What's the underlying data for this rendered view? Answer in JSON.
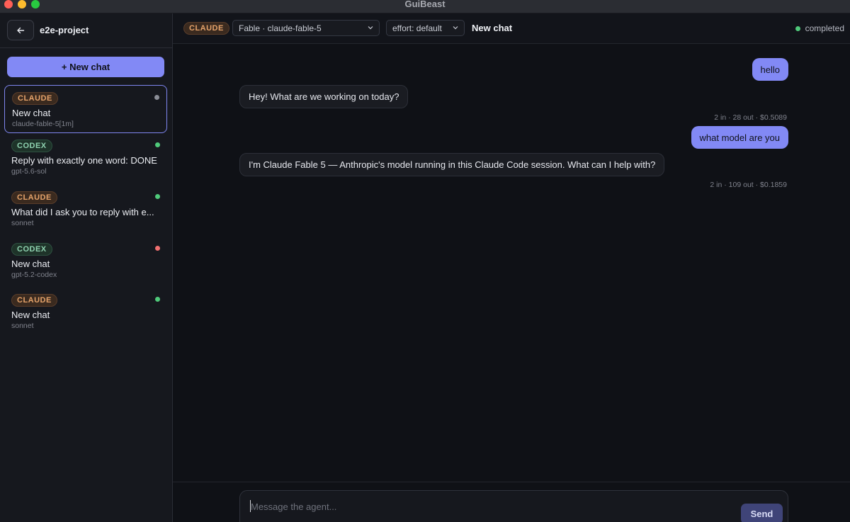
{
  "window": {
    "title": "GuiBeast"
  },
  "sidebar": {
    "back_icon": "arrow-left-icon",
    "project_name": "e2e-project",
    "new_chat_label": "+ New chat",
    "chats": [
      {
        "provider": "CLAUDE",
        "title": "New chat",
        "model": "claude-fable-5[1m]",
        "status_color": "#8a8d96",
        "selected": true
      },
      {
        "provider": "CODEX",
        "title": "Reply with exactly one word: DONE",
        "model": "gpt-5.6-sol",
        "status_color": "#4fc97a",
        "selected": false
      },
      {
        "provider": "CLAUDE",
        "title": "What did I ask you to reply with e...",
        "model": "sonnet",
        "status_color": "#4fc97a",
        "selected": false
      },
      {
        "provider": "CODEX",
        "title": "New chat",
        "model": "gpt-5.2-codex",
        "status_color": "#f07070",
        "selected": false
      },
      {
        "provider": "CLAUDE",
        "title": "New chat",
        "model": "sonnet",
        "status_color": "#4fc97a",
        "selected": false
      }
    ]
  },
  "topbar": {
    "provider_badge": "CLAUDE",
    "model_select_value": "Fable · claude-fable-5",
    "effort_select_value": "effort: default",
    "chat_title": "New chat",
    "status_text": "completed",
    "status_color": "#4fc97a"
  },
  "messages": [
    {
      "role": "user",
      "text": "hello"
    },
    {
      "role": "agent",
      "text": "Hey! What are we working on today?",
      "meta": "2 in · 28 out · $0.5089"
    },
    {
      "role": "user",
      "text": "what model are you"
    },
    {
      "role": "agent",
      "text": "I'm Claude Fable 5 — Anthropic's model running in this Claude Code session. What can I help with?",
      "meta": "2 in · 109 out · $0.1859"
    }
  ],
  "composer": {
    "placeholder": "Message the agent...",
    "value": "",
    "send_label": "Send"
  },
  "colors": {
    "accent": "#8289f5",
    "claude_badge": "#e5a36a",
    "codex_badge": "#8fd3b0"
  }
}
